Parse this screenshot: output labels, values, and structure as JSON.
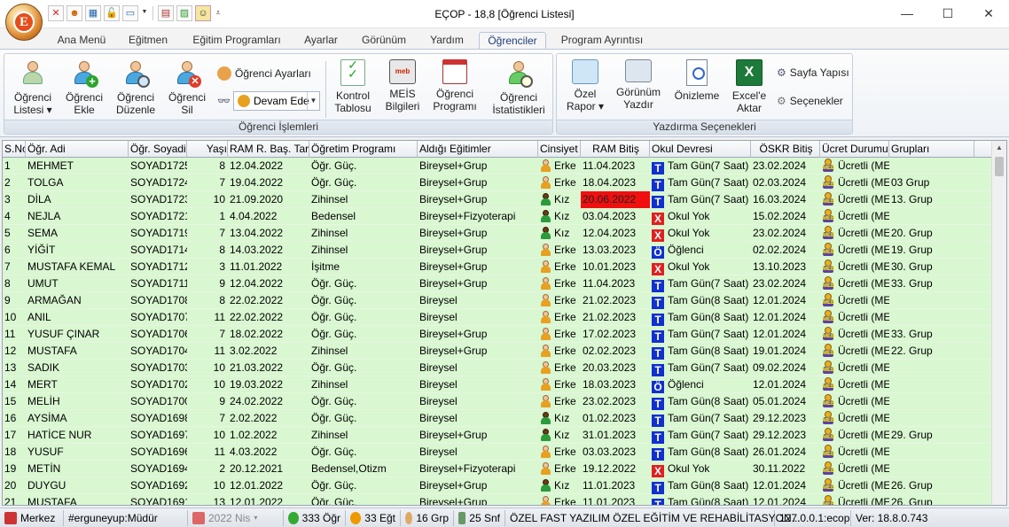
{
  "window": {
    "title": "EÇOP - 18,8 [Öğrenci Listesi]",
    "app_logo_letter": "E",
    "controls": {
      "minimize": "—",
      "maximize": "☐",
      "close": "✕"
    }
  },
  "quick_access": [
    "close-icon",
    "users-icon",
    "grid-icon",
    "lock-icon",
    "window-icon",
    "calendar-icon",
    "image-icon",
    "person-icon"
  ],
  "tabs": [
    {
      "label": "Ana Menü"
    },
    {
      "label": "Eğitmen"
    },
    {
      "label": "Eğitim Programları"
    },
    {
      "label": "Ayarlar"
    },
    {
      "label": "Görünüm"
    },
    {
      "label": "Yardım"
    },
    {
      "label": "Öğrenciler",
      "active": true
    },
    {
      "label": "Program Ayrıntısı"
    }
  ],
  "ribbon": {
    "ogrenci_group": {
      "label": "Öğrenci İşlemleri",
      "buttons": [
        {
          "line1": "Öğrenci",
          "line2": "Listesi ▾"
        },
        {
          "line1": "Öğrenci",
          "line2": "Ekle"
        },
        {
          "line1": "Öğrenci",
          "line2": "Düzenle"
        },
        {
          "line1": "Öğrenci",
          "line2": "Sil"
        }
      ],
      "settings_label": "Öğrenci Ayarları",
      "status_combo": "Devam Ede",
      "buttons2": [
        {
          "line1": "Kontrol",
          "line2": "Tablosu"
        },
        {
          "line1": "MEİS",
          "line2": "Bilgileri"
        },
        {
          "line1": "Öğrenci",
          "line2": "Programı"
        },
        {
          "line1": "Öğrenci",
          "line2": "İstatistikleri"
        }
      ]
    },
    "print_group": {
      "label": "Yazdırma Seçenekleri",
      "buttons": [
        {
          "line1": "Özel",
          "line2": "Rapor ▾"
        },
        {
          "line1": "Görünüm",
          "line2": "Yazdır"
        },
        {
          "line1": "Önizleme",
          "line2": ""
        },
        {
          "line1": "Excel'e",
          "line2": "Aktar"
        }
      ],
      "page_setup": "Sayfa Yapısı",
      "options": "Seçenekler"
    }
  },
  "grid": {
    "columns": [
      "S.No",
      "Öğr. Adi",
      "Öğr. Soyadi",
      "Yaşı",
      "RAM R. Baş. Tarih",
      "Öğretim Programı",
      "Aldığı Eğitimler",
      "Cinsiyet",
      "RAM Bitiş",
      "Okul Devresi",
      "ÖSKR Bitiş",
      "Ücret Durumu",
      "Grupları"
    ],
    "rows": [
      {
        "no": "1",
        "ad": "MEHMET",
        "soyad": "SOYAD1725",
        "yas": "8",
        "ram": "12.04.2022",
        "prog": "Öğr. Güç.",
        "egitim": "Bireysel+Grup",
        "cins": "Erke",
        "g": "m",
        "bitis": "11.04.2023",
        "red": false,
        "dev": "T",
        "devre": "Tam Gün(7 Saat)",
        "oskr": "23.02.2024",
        "ucret": "Ücretli (ME",
        "grup": ""
      },
      {
        "no": "2",
        "ad": "TOLGA",
        "soyad": "SOYAD1724",
        "yas": "7",
        "ram": "19.04.2022",
        "prog": "Öğr. Güç.",
        "egitim": "Bireysel+Grup",
        "cins": "Erke",
        "g": "m",
        "bitis": "18.04.2023",
        "red": false,
        "dev": "T",
        "devre": "Tam Gün(7 Saat)",
        "oskr": "02.03.2024",
        "ucret": "Ücretli (ME",
        "grup": "03 Grup"
      },
      {
        "no": "3",
        "ad": "DİLA",
        "soyad": "SOYAD1723",
        "yas": "10",
        "ram": "21.09.2020",
        "prog": "Zihinsel",
        "egitim": "Bireysel+Grup",
        "cins": "Kız",
        "g": "f",
        "bitis": "20.06.2022",
        "red": true,
        "dev": "T",
        "devre": "Tam Gün(7 Saat)",
        "oskr": "16.03.2024",
        "ucret": "Ücretli (ME",
        "grup": "13. Grup"
      },
      {
        "no": "4",
        "ad": "NEJLA",
        "soyad": "SOYAD1721",
        "yas": "1",
        "ram": "4.04.2022",
        "prog": "Bedensel",
        "egitim": "Bireysel+Fizyoterapi",
        "cins": "Kız",
        "g": "f",
        "bitis": "03.04.2023",
        "red": false,
        "dev": "X",
        "devre": "Okul Yok",
        "oskr": "15.02.2024",
        "ucret": "Ücretli (ME",
        "grup": ""
      },
      {
        "no": "5",
        "ad": "SEMA",
        "soyad": "SOYAD1719",
        "yas": "7",
        "ram": "13.04.2022",
        "prog": "Zihinsel",
        "egitim": "Bireysel+Grup",
        "cins": "Kız",
        "g": "f",
        "bitis": "12.04.2023",
        "red": false,
        "dev": "X",
        "devre": "Okul Yok",
        "oskr": "23.02.2024",
        "ucret": "Ücretli (ME",
        "grup": "20. Grup"
      },
      {
        "no": "6",
        "ad": "YİĞİT",
        "soyad": "SOYAD1714",
        "yas": "8",
        "ram": "14.03.2022",
        "prog": "Zihinsel",
        "egitim": "Bireysel+Grup",
        "cins": "Erke",
        "g": "m",
        "bitis": "13.03.2023",
        "red": false,
        "dev": "O",
        "devre": "Öğlenci",
        "oskr": "02.02.2024",
        "ucret": "Ücretli (ME",
        "grup": "19. Grup"
      },
      {
        "no": "7",
        "ad": "MUSTAFA KEMAL",
        "soyad": "SOYAD1712",
        "yas": "3",
        "ram": "11.01.2022",
        "prog": "İşitme",
        "egitim": "Bireysel+Grup",
        "cins": "Erke",
        "g": "m",
        "bitis": "10.01.2023",
        "red": false,
        "dev": "X",
        "devre": "Okul Yok",
        "oskr": "13.10.2023",
        "ucret": "Ücretli (ME",
        "grup": "30. Grup"
      },
      {
        "no": "8",
        "ad": "UMUT",
        "soyad": "SOYAD1711",
        "yas": "9",
        "ram": "12.04.2022",
        "prog": "Öğr. Güç.",
        "egitim": "Bireysel+Grup",
        "cins": "Erke",
        "g": "m",
        "bitis": "11.04.2023",
        "red": false,
        "dev": "T",
        "devre": "Tam Gün(7 Saat)",
        "oskr": "23.02.2024",
        "ucret": "Ücretli (ME",
        "grup": "33. Grup"
      },
      {
        "no": "9",
        "ad": "ARMAĞAN",
        "soyad": "SOYAD1708",
        "yas": "8",
        "ram": "22.02.2022",
        "prog": "Öğr. Güç.",
        "egitim": "Bireysel",
        "cins": "Erke",
        "g": "m",
        "bitis": "21.02.2023",
        "red": false,
        "dev": "T",
        "devre": "Tam Gün(8 Saat)",
        "oskr": "12.01.2024",
        "ucret": "Ücretli (ME",
        "grup": ""
      },
      {
        "no": "10",
        "ad": "ANIL",
        "soyad": "SOYAD1707",
        "yas": "11",
        "ram": "22.02.2022",
        "prog": "Öğr. Güç.",
        "egitim": "Bireysel",
        "cins": "Erke",
        "g": "m",
        "bitis": "21.02.2023",
        "red": false,
        "dev": "T",
        "devre": "Tam Gün(8 Saat)",
        "oskr": "12.01.2024",
        "ucret": "Ücretli (ME",
        "grup": ""
      },
      {
        "no": "11",
        "ad": "YUSUF ÇINAR",
        "soyad": "SOYAD1706",
        "yas": "7",
        "ram": "18.02.2022",
        "prog": "Öğr. Güç.",
        "egitim": "Bireysel+Grup",
        "cins": "Erke",
        "g": "m",
        "bitis": "17.02.2023",
        "red": false,
        "dev": "T",
        "devre": "Tam Gün(7 Saat)",
        "oskr": "12.01.2024",
        "ucret": "Ücretli (ME",
        "grup": "33. Grup"
      },
      {
        "no": "12",
        "ad": "MUSTAFA",
        "soyad": "SOYAD1704",
        "yas": "11",
        "ram": "3.02.2022",
        "prog": "Zihinsel",
        "egitim": "Bireysel+Grup",
        "cins": "Erke",
        "g": "m",
        "bitis": "02.02.2023",
        "red": false,
        "dev": "T",
        "devre": "Tam Gün(8 Saat)",
        "oskr": "19.01.2024",
        "ucret": "Ücretli (ME",
        "grup": "22. Grup"
      },
      {
        "no": "13",
        "ad": "SADIK",
        "soyad": "SOYAD1703",
        "yas": "10",
        "ram": "21.03.2022",
        "prog": "Öğr. Güç.",
        "egitim": "Bireysel",
        "cins": "Erke",
        "g": "m",
        "bitis": "20.03.2023",
        "red": false,
        "dev": "T",
        "devre": "Tam Gün(7 Saat)",
        "oskr": "09.02.2024",
        "ucret": "Ücretli (ME",
        "grup": ""
      },
      {
        "no": "14",
        "ad": "MERT",
        "soyad": "SOYAD1702",
        "yas": "10",
        "ram": "19.03.2022",
        "prog": "Zihinsel",
        "egitim": "Bireysel",
        "cins": "Erke",
        "g": "m",
        "bitis": "18.03.2023",
        "red": false,
        "dev": "O",
        "devre": "Öğlenci",
        "oskr": "12.01.2024",
        "ucret": "Ücretli (ME",
        "grup": ""
      },
      {
        "no": "15",
        "ad": "MELİH",
        "soyad": "SOYAD1700",
        "yas": "9",
        "ram": "24.02.2022",
        "prog": "Öğr. Güç.",
        "egitim": "Bireysel",
        "cins": "Erke",
        "g": "m",
        "bitis": "23.02.2023",
        "red": false,
        "dev": "T",
        "devre": "Tam Gün(8 Saat)",
        "oskr": "05.01.2024",
        "ucret": "Ücretli (ME",
        "grup": ""
      },
      {
        "no": "16",
        "ad": "AYSİMA",
        "soyad": "SOYAD1698",
        "yas": "7",
        "ram": "2.02.2022",
        "prog": "Öğr. Güç.",
        "egitim": "Bireysel",
        "cins": "Kız",
        "g": "f",
        "bitis": "01.02.2023",
        "red": false,
        "dev": "T",
        "devre": "Tam Gün(7 Saat)",
        "oskr": "29.12.2023",
        "ucret": "Ücretli (ME",
        "grup": ""
      },
      {
        "no": "17",
        "ad": "HATİCE NUR",
        "soyad": "SOYAD1697",
        "yas": "10",
        "ram": "1.02.2022",
        "prog": "Zihinsel",
        "egitim": "Bireysel+Grup",
        "cins": "Kız",
        "g": "f",
        "bitis": "31.01.2023",
        "red": false,
        "dev": "T",
        "devre": "Tam Gün(7 Saat)",
        "oskr": "29.12.2023",
        "ucret": "Ücretli (ME",
        "grup": "29. Grup"
      },
      {
        "no": "18",
        "ad": "YUSUF",
        "soyad": "SOYAD1696",
        "yas": "11",
        "ram": "4.03.2022",
        "prog": "Öğr. Güç.",
        "egitim": "Bireysel",
        "cins": "Erke",
        "g": "m",
        "bitis": "03.03.2023",
        "red": false,
        "dev": "T",
        "devre": "Tam Gün(8 Saat)",
        "oskr": "26.01.2024",
        "ucret": "Ücretli (ME",
        "grup": ""
      },
      {
        "no": "19",
        "ad": "METİN",
        "soyad": "SOYAD1694",
        "yas": "2",
        "ram": "20.12.2021",
        "prog": "Bedensel,Otizm",
        "egitim": "Bireysel+Fizyoterapi",
        "cins": "Erke",
        "g": "m",
        "bitis": "19.12.2022",
        "red": false,
        "dev": "X",
        "devre": "Okul Yok",
        "oskr": "30.11.2022",
        "ucret": "Ücretli (ME",
        "grup": ""
      },
      {
        "no": "20",
        "ad": "DUYGU",
        "soyad": "SOYAD1692",
        "yas": "10",
        "ram": "12.01.2022",
        "prog": "Öğr. Güç.",
        "egitim": "Bireysel+Grup",
        "cins": "Kız",
        "g": "f",
        "bitis": "11.01.2023",
        "red": false,
        "dev": "T",
        "devre": "Tam Gün(8 Saat)",
        "oskr": "12.01.2024",
        "ucret": "Ücretli (ME",
        "grup": "26. Grup"
      },
      {
        "no": "21",
        "ad": "MUSTAFA",
        "soyad": "SOYAD1691",
        "yas": "13",
        "ram": "12.01.2022",
        "prog": "Öğr. Güç.",
        "egitim": "Bireysel+Grup",
        "cins": "Erke",
        "g": "m",
        "bitis": "11.01.2023",
        "red": false,
        "dev": "T",
        "devre": "Tam Gün(8 Saat)",
        "oskr": "12.01.2024",
        "ucret": "Ücretli (ME",
        "grup": "26. Grup"
      }
    ],
    "dev_letters": {
      "T": "T",
      "X": "X",
      "O": "Ö"
    },
    "meb_badge": "MEB"
  },
  "statusbar": {
    "branch": "Merkez",
    "user": "#erguneyup:Müdür",
    "period": "2022 Nis",
    "students": "333 Öğr",
    "teachers": "33 Eğt",
    "groups": "16 Grp",
    "classes": "25 Snf",
    "institution": "ÖZEL FAST YAZILIM ÖZEL EĞİTİM VE REHABİLİTASYON...",
    "server": "127.0.0.1:ecop",
    "version": "Ver: 18.8.0.743"
  }
}
